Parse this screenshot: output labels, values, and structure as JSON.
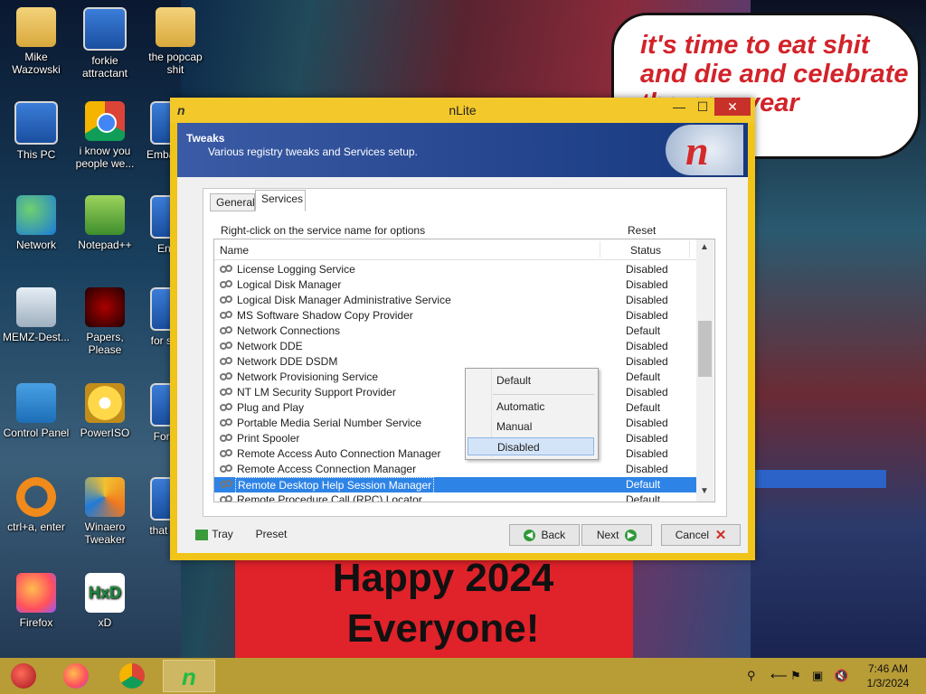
{
  "desktop": {
    "bubble_text": "it's time to eat shit and die and celebrate the new year",
    "poster_text": "Happy 2024 Everyone!",
    "icons": [
      {
        "label": "Mike Wazowski",
        "icon": "folder-user-icon"
      },
      {
        "label": "forkie attractant",
        "icon": "computer-settings-icon"
      },
      {
        "label": "the popcap shit",
        "icon": "folder-icon"
      },
      {
        "label": "This PC",
        "icon": "this-pc-icon"
      },
      {
        "label": "i know you people we...",
        "icon": "chrome-icon"
      },
      {
        "label": "Emba Dev",
        "icon": "shortcut-icon"
      },
      {
        "label": "Network",
        "icon": "network-icon"
      },
      {
        "label": "Notepad++",
        "icon": "notepadpp-icon"
      },
      {
        "label": "Ender",
        "icon": "shortcut-icon"
      },
      {
        "label": "MEMZ-Dest...",
        "icon": "recycle-bin-icon"
      },
      {
        "label": "Papers, Please",
        "icon": "papers-please-icon"
      },
      {
        "label": "for some",
        "icon": "shortcut-icon"
      },
      {
        "label": "Control Panel",
        "icon": "control-panel-icon"
      },
      {
        "label": "PowerISO",
        "icon": "poweriso-icon"
      },
      {
        "label": "Forza 5",
        "icon": "shortcut-icon"
      },
      {
        "label": "ctrl+a, enter",
        "icon": "ring-icon"
      },
      {
        "label": "Winaero Tweaker",
        "icon": "winaero-icon"
      },
      {
        "label": "that b... it",
        "icon": "shortcut-icon"
      },
      {
        "label": "Firefox",
        "icon": "firefox-icon"
      },
      {
        "label": "xD",
        "icon": "hxd-icon"
      }
    ]
  },
  "window": {
    "title": "nLite",
    "minimize_label": "—",
    "maximize_label": "☐",
    "close_label": "✕",
    "header": {
      "title": "Tweaks",
      "subtitle": "Various registry tweaks and Services setup."
    },
    "tabs": [
      {
        "label": "General",
        "active": false
      },
      {
        "label": "Services",
        "active": true
      }
    ],
    "hint": "Right-click on the service name for options",
    "reset_label": "Reset",
    "columns": {
      "name": "Name",
      "status": "Status"
    },
    "services": [
      {
        "name": "License Logging Service",
        "status": "Disabled"
      },
      {
        "name": "Logical Disk Manager",
        "status": "Disabled"
      },
      {
        "name": "Logical Disk Manager Administrative Service",
        "status": "Disabled"
      },
      {
        "name": "MS Software Shadow Copy Provider",
        "status": "Disabled"
      },
      {
        "name": "Network Connections",
        "status": "Default"
      },
      {
        "name": "Network DDE",
        "status": "Disabled"
      },
      {
        "name": "Network DDE DSDM",
        "status": "Disabled"
      },
      {
        "name": "Network Provisioning Service",
        "status": "Default"
      },
      {
        "name": "NT LM Security Support Provider",
        "status": "Disabled"
      },
      {
        "name": "Plug and Play",
        "status": "Default"
      },
      {
        "name": "Portable Media Serial Number Service",
        "status": "Disabled"
      },
      {
        "name": "Print Spooler",
        "status": "Disabled"
      },
      {
        "name": "Remote Access Auto Connection Manager",
        "status": "Disabled"
      },
      {
        "name": "Remote Access Connection Manager",
        "status": "Disabled"
      },
      {
        "name": "Remote Desktop Help Session Manager",
        "status": "Default",
        "selected": true
      },
      {
        "name": "Remote Procedure Call (RPC) Locator",
        "status": "Default"
      }
    ],
    "context_menu": [
      {
        "label": "Default"
      },
      {
        "label": "Automatic"
      },
      {
        "label": "Manual"
      },
      {
        "label": "Disabled",
        "highlighted": true
      }
    ],
    "footer": {
      "tray_label": "Tray",
      "preset_label": "Preset",
      "back_label": "Back",
      "next_label": "Next",
      "cancel_label": "Cancel"
    }
  },
  "taskbar": {
    "apps": [
      "ornament-start-icon",
      "firefox-icon",
      "chrome-icon",
      "nlite-icon"
    ],
    "active_app": "nlite-icon",
    "clock_time": "7:46 AM",
    "clock_date": "1/3/2024"
  },
  "colors": {
    "window_frame": "#f0c419",
    "header_blue": "#16387e",
    "selection": "#2e84e6",
    "taskbar": "#b89c36",
    "close_red": "#c7312a"
  }
}
